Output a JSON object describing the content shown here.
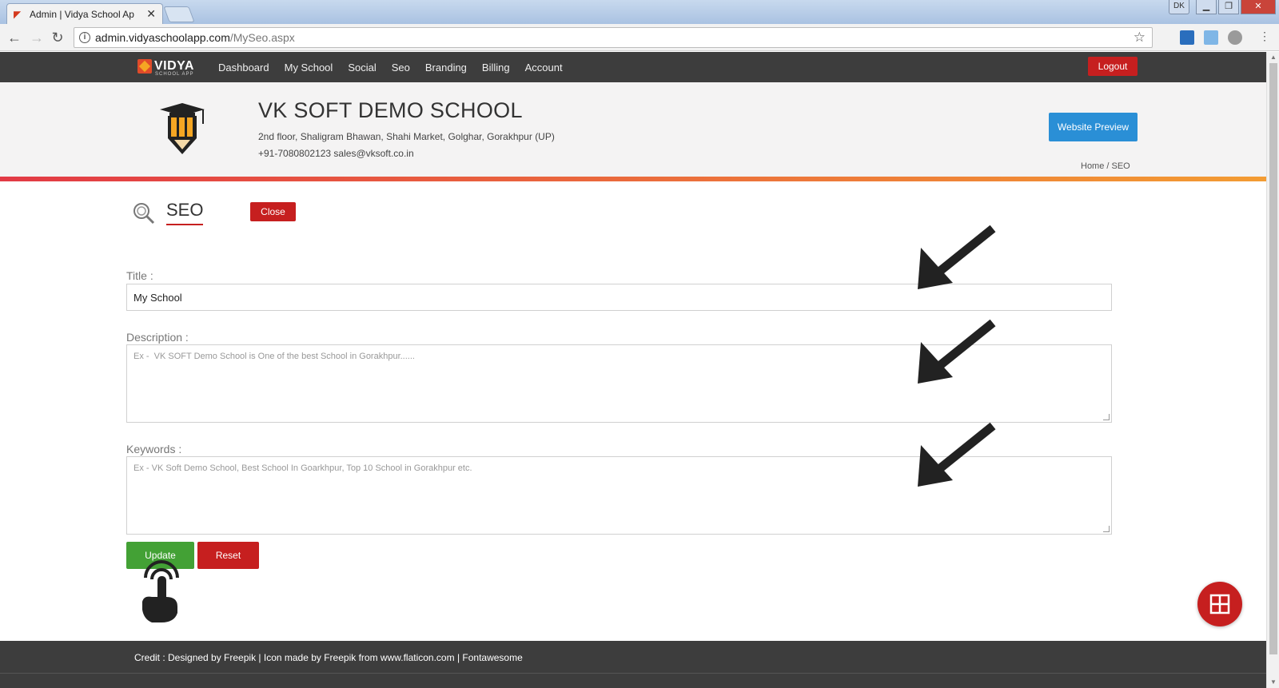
{
  "browser": {
    "tab_title": "Admin | Vidya School Ap",
    "url_host": "admin.vidyaschoolapp.com",
    "url_path": "/MySeo.aspx",
    "profile": "DK"
  },
  "nav": {
    "logo_text": "VIDYA",
    "logo_sub": "SCHOOL APP",
    "items": [
      "Dashboard",
      "My School",
      "Social",
      "Seo",
      "Branding",
      "Billing",
      "Account"
    ],
    "logout": "Logout"
  },
  "school": {
    "name": "VK SOFT DEMO SCHOOL",
    "address": "2nd floor, Shaligram Bhawan, Shahi Market, Golghar, Gorakhpur (UP)",
    "contact": "+91-7080802123  sales@vksoft.co.in",
    "preview_button": "Website Preview",
    "breadcrumb": "Home / SEO"
  },
  "seo": {
    "heading": "SEO",
    "close_button": "Close",
    "title_label": "Title :",
    "title_value": "My School",
    "description_label": "Description :",
    "description_placeholder": "Ex -  VK SOFT Demo School is One of the best School in Gorakhpur......",
    "keywords_label": "Keywords :",
    "keywords_placeholder": "Ex - VK Soft Demo School, Best School In Goarkhpur, Top 10 School in Gorakhpur etc.",
    "update_button": "Update",
    "reset_button": "Reset"
  },
  "footer": {
    "credit": "Credit : Designed by Freepik | Icon made by Freepik from www.flaticon.com | Fontawesome"
  },
  "colors": {
    "nav_bg": "#3d3d3d",
    "danger": "#c61f1f",
    "success": "#43a135",
    "primary": "#2a8fd6"
  }
}
